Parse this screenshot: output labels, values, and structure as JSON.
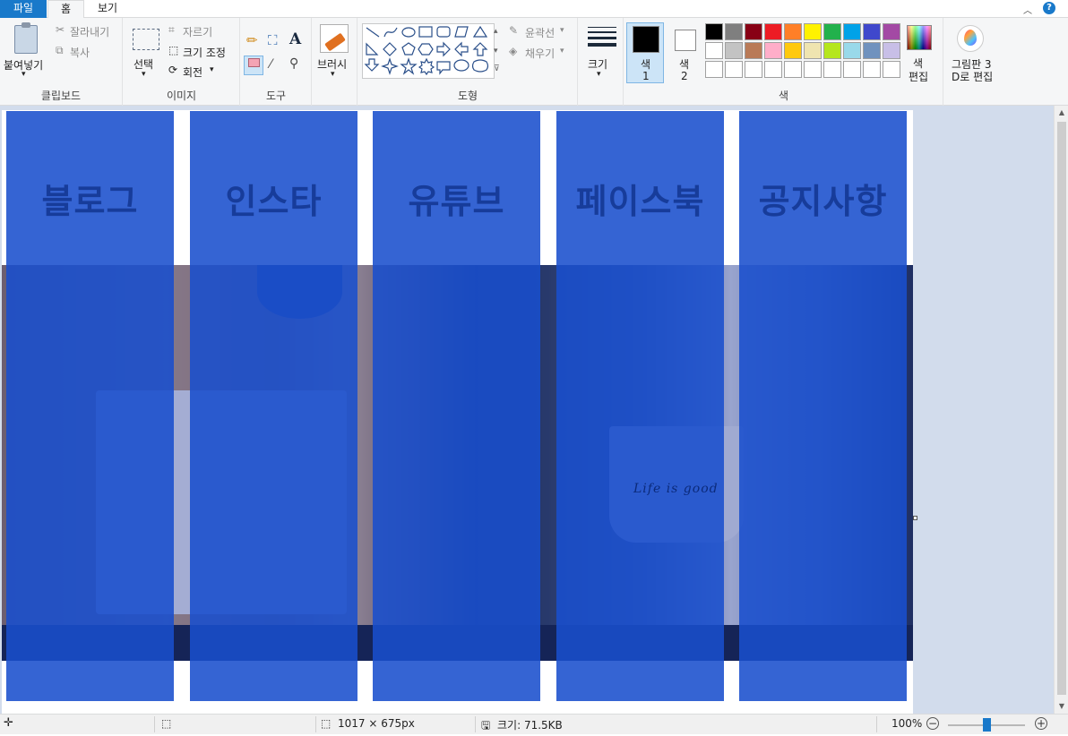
{
  "tabs": {
    "file": "파일",
    "home": "홈",
    "view": "보기"
  },
  "help_icon": "help-icon",
  "clipboard": {
    "paste": "붙여넣기",
    "cut": "잘라내기",
    "copy": "복사",
    "group": "클립보드"
  },
  "image": {
    "select": "선택",
    "crop": "자르기",
    "resize": "크기 조정",
    "rotate": "회전",
    "group": "이미지"
  },
  "tools": {
    "group": "도구"
  },
  "brushes": {
    "label": "브러시"
  },
  "shapes": {
    "outline": "윤곽선",
    "fill": "채우기",
    "group": "도형"
  },
  "size": {
    "label": "크기"
  },
  "colors": {
    "color1_label": "색",
    "color1_num": "1",
    "color2_label": "색",
    "color2_num": "2",
    "color1_value": "#000000",
    "color2_value": "#ffffff",
    "edit_label": "색",
    "edit_label2": "편집",
    "group": "색",
    "palette_row1": [
      "#000000",
      "#7f7f7f",
      "#880015",
      "#ed1c24",
      "#ff7f27",
      "#fff200",
      "#22b14c",
      "#00a2e8",
      "#3f48cc",
      "#a349a4"
    ],
    "palette_row2": [
      "#ffffff",
      "#c3c3c3",
      "#b97a57",
      "#ffaec9",
      "#ffc90e",
      "#efe4b0",
      "#b5e61d",
      "#99d9ea",
      "#7092be",
      "#c8bfe7"
    ],
    "palette_row3": [
      "#ffffff",
      "#ffffff",
      "#ffffff",
      "#ffffff",
      "#ffffff",
      "#ffffff",
      "#ffffff",
      "#ffffff",
      "#ffffff",
      "#ffffff"
    ]
  },
  "paint3d": {
    "line1": "그림판 3",
    "line2": "D로 편집"
  },
  "canvas": {
    "columns": [
      {
        "label": "블로그"
      },
      {
        "label": "인스타"
      },
      {
        "label": "유튜브"
      },
      {
        "label": "페이스북"
      },
      {
        "label": "공지사항"
      }
    ],
    "mug_text": "Life is good"
  },
  "status": {
    "dimensions": "1017 × 675px",
    "filesize": "크기: 71.5KB",
    "zoom": "100%"
  }
}
